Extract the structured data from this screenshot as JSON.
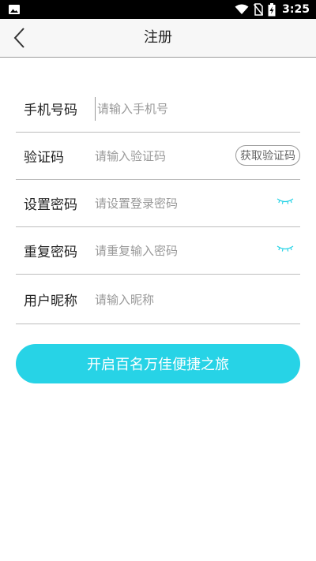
{
  "status_bar": {
    "time": "3:25",
    "icons": [
      "image-icon",
      "wifi-icon",
      "no-sim-icon",
      "battery-charging-icon"
    ]
  },
  "header": {
    "title": "注册",
    "back_icon": "chevron-left-icon"
  },
  "form": {
    "phone": {
      "label": "手机号码",
      "placeholder": "请输入手机号",
      "value": ""
    },
    "code": {
      "label": "验证码",
      "placeholder": "请输入验证码",
      "value": "",
      "button_label": "获取验证码"
    },
    "password": {
      "label": "设置密码",
      "placeholder": "请设置登录密码",
      "value": "",
      "toggle_icon": "eye-closed-icon"
    },
    "repeat_password": {
      "label": "重复密码",
      "placeholder": "请重复输入密码",
      "value": "",
      "toggle_icon": "eye-closed-icon"
    },
    "nickname": {
      "label": "用户昵称",
      "placeholder": "请输入昵称",
      "value": ""
    }
  },
  "submit": {
    "label": "开启百名万佳便捷之旅"
  },
  "colors": {
    "accent": "#27d3e6",
    "divider": "#bdbdbd",
    "header_bg": "#f7f7f7",
    "status_bar_bg": "#000000",
    "placeholder": "#999999"
  }
}
